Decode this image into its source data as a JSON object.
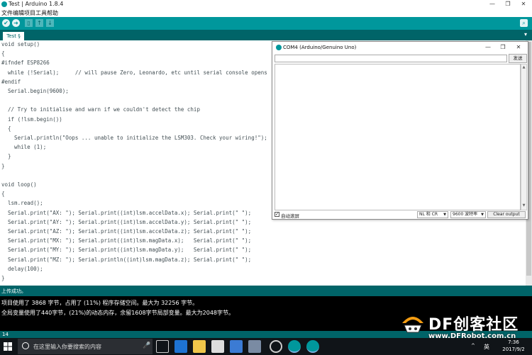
{
  "window": {
    "title": "Test | Arduino 1.8.4",
    "minimize": "—",
    "maximize": "❐",
    "close": "✕"
  },
  "menu": [
    "文件",
    "编辑",
    "项目",
    "工具",
    "帮助"
  ],
  "toolbar": {
    "verify_icon": "check-icon",
    "upload_icon": "arrow-right-icon",
    "new_icon": "new-file-icon",
    "open_icon": "arrow-up-icon",
    "save_icon": "arrow-down-icon",
    "serial_icon": "magnifier-icon",
    "accent": "#00979c",
    "dark": "#006468"
  },
  "tabs": [
    {
      "label": "Test §"
    }
  ],
  "tab_menu": "▾",
  "code": [
    {
      "t": "void setup()"
    },
    {
      "t": "{"
    },
    {
      "t": "#ifndef ESP8266"
    },
    {
      "t": "  while (!Serial);     // will pause Zero, Leonardo, etc until serial console opens"
    },
    {
      "t": "#endif"
    },
    {
      "t": "  Serial.begin(9600);"
    },
    {
      "t": ""
    },
    {
      "t": "  // Try to initialise and warn if we couldn't detect the chip"
    },
    {
      "t": "  if (!lsm.begin())"
    },
    {
      "t": "  {"
    },
    {
      "t": "    Serial.println(\"Oops ... unable to initialize the LSM303. Check your wiring!\");"
    },
    {
      "t": "    while (1);"
    },
    {
      "t": "  }"
    },
    {
      "t": "}"
    },
    {
      "t": ""
    },
    {
      "t": "void loop()"
    },
    {
      "t": "{"
    },
    {
      "t": "  lsm.read();"
    },
    {
      "t": "  Serial.print(\"AX: \"); Serial.print((int)lsm.accelData.x); Serial.print(\" \");"
    },
    {
      "t": "  Serial.print(\"AY: \"); Serial.print((int)lsm.accelData.y); Serial.print(\" \");"
    },
    {
      "t": "  Serial.print(\"AZ: \"); Serial.print((int)lsm.accelData.z); Serial.print(\" \");"
    },
    {
      "t": "  Serial.print(\"MX: \"); Serial.print((int)lsm.magData.x);   Serial.print(\" \");"
    },
    {
      "t": "  Serial.print(\"MY: \"); Serial.print((int)lsm.magData.y);   Serial.print(\" \");"
    },
    {
      "t": "  Serial.print(\"MZ: \"); Serial.println((int)lsm.magData.z); Serial.print(\" \");"
    },
    {
      "t": "  delay(100);"
    },
    {
      "t": "}"
    }
  ],
  "status": {
    "message": "上传成功。"
  },
  "console": {
    "lines": [
      "项目使用了 3868 字节，占用了 (11%) 程序存储空间。最大为 32256 字节。",
      "全局变量使用了440字节，(21%)的动态内存，余留1608字节局部变量。最大为2048字节。"
    ]
  },
  "line_number": "14",
  "serial_monitor": {
    "title": "COM4 (Arduino/Genuino Uno)",
    "input_value": "",
    "send_label": "发送",
    "autoscroll_label": "自动滚屏",
    "autoscroll_checked": true,
    "check_mark": "✓",
    "line_ending": "NL 和 CR",
    "baud_rate": "9600 波特率",
    "clear_label": "Clear output",
    "caret": "▼",
    "scroll_up": "▲",
    "scroll_down": "▼"
  },
  "watermark": {
    "brand": "DF创客社区",
    "url": "www.DFRobot.com.cn"
  },
  "taskbar": {
    "search_placeholder": "在这里输入你要搜索的内容",
    "mic_icon": "🎤",
    "ime": "英",
    "tray_up": "^",
    "time": "7:36",
    "date": "2017/9/2"
  }
}
